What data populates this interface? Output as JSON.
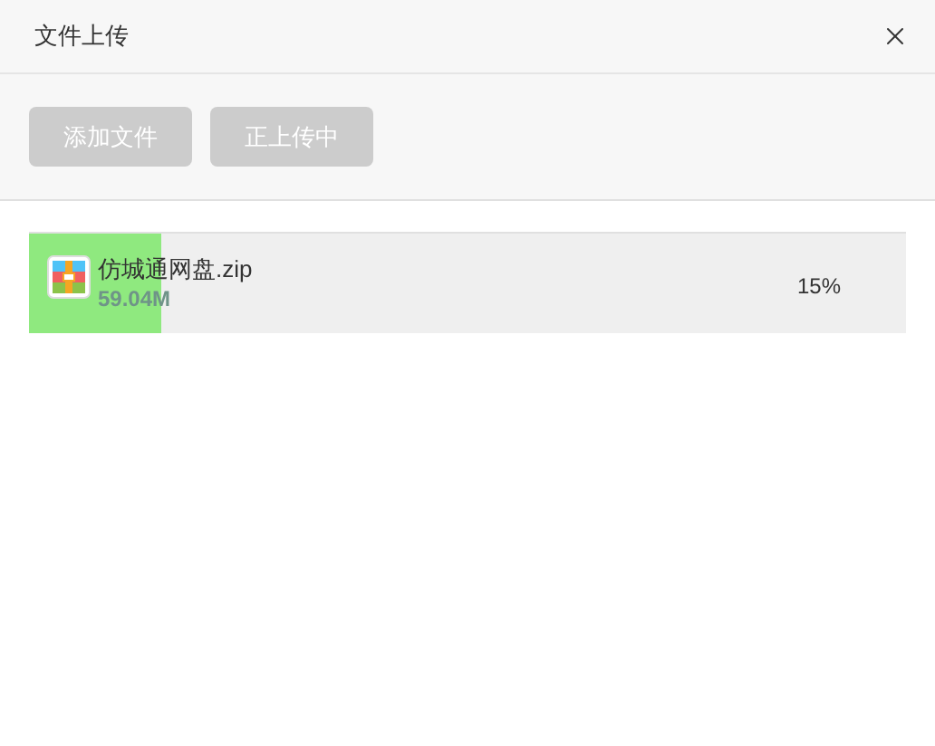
{
  "dialog": {
    "title": "文件上传"
  },
  "buttons": [
    {
      "label": "添加文件",
      "disabled": true
    },
    {
      "label": "正上传中",
      "disabled": true
    }
  ],
  "files": [
    {
      "name": "仿城通网盘.zip",
      "size": "59.04M",
      "level": 0.15,
      "percent": "15%"
    }
  ]
}
